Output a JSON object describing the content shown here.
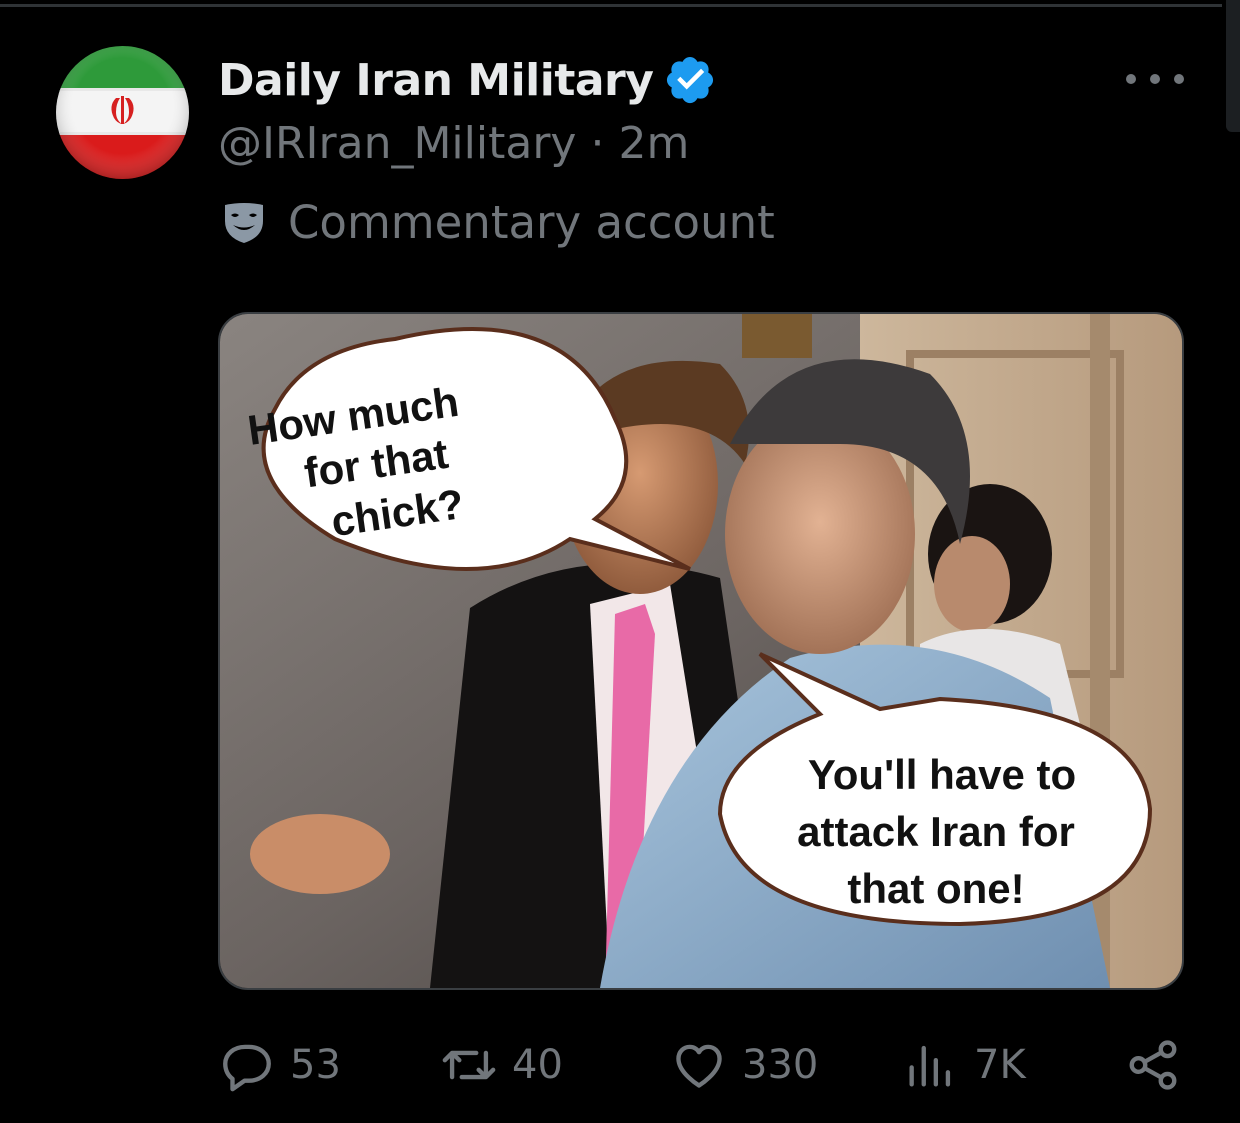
{
  "author": {
    "display_name": "Daily Iran Military",
    "verified_icon": "verified-badge-icon",
    "handle": "@IRIran_Military",
    "separator": "·",
    "timestamp": "2m",
    "label_icon": "theater-mask-icon",
    "label": "Commentary account",
    "avatar_description": "iran-flag"
  },
  "media": {
    "bubble_top": [
      "How much",
      "for that",
      "chick?"
    ],
    "bubble_bottom": [
      "You'll have to",
      "attack Iran for",
      "that one!"
    ]
  },
  "actions": {
    "replies": "53",
    "reposts": "40",
    "likes": "330",
    "views": "7K"
  },
  "colors": {
    "background": "#000000",
    "primary_text": "#e7e9ea",
    "secondary_text": "#71767b",
    "verified_blue": "#1d9bf0"
  }
}
